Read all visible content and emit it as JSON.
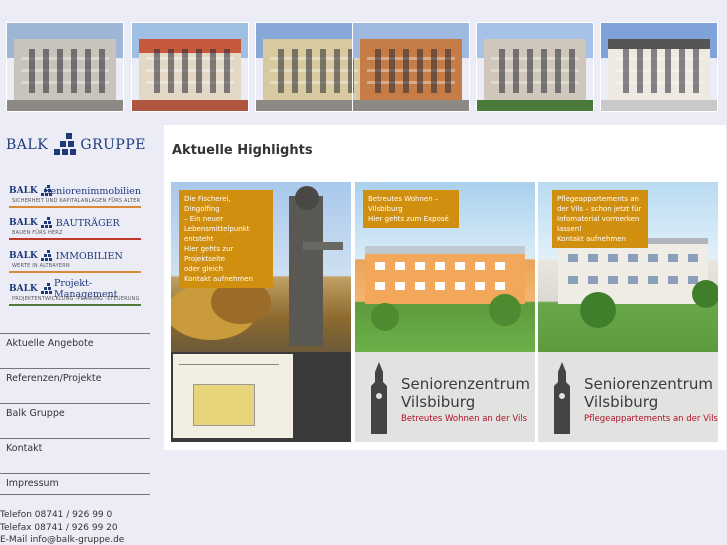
{
  "header": {
    "photos": [
      {
        "name": "photo-apartment-1",
        "sky": "#9db6d6",
        "building": "#c9c4bb"
      },
      {
        "name": "photo-apartment-2",
        "sky": "#9fc0e3",
        "building": "#c7573d"
      },
      {
        "name": "photo-apartment-3",
        "sky": "#88a9d8",
        "building": "#d8c9a0"
      },
      {
        "name": "photo-apartment-4",
        "sky": "#9fb8df",
        "building": "#c57c47"
      },
      {
        "name": "photo-apartment-5",
        "sky": "#a6c2e8",
        "building": "#cfc7bb"
      },
      {
        "name": "photo-apartment-6",
        "sky": "#7fa2d8",
        "building": "#eeeae2"
      }
    ]
  },
  "sidebar": {
    "logo": {
      "left": "BALK",
      "right": "GRUPPE"
    },
    "brands": [
      {
        "name": "BALK",
        "suffix": "Seniorenimmobilien",
        "tagline": "SICHERHEIT UND KAPITALANLAGEN FÜRS ALTER",
        "line_color": "#d9893a"
      },
      {
        "name": "BALK",
        "suffix": "BAUTRÄGER",
        "tagline": "BAUEN FÜRS HERZ",
        "line_color": "#c0392b"
      },
      {
        "name": "BALK",
        "suffix": "IMMOBILIEN",
        "tagline": "WERTE IN ALTBAYERN",
        "line_color": "#d9893a"
      },
      {
        "name": "BALK",
        "suffix": "Projekt-Management",
        "tagline": "PROJEKTENTWICKLUNG -PLANUNG -STEUERUNG",
        "line_color": "#4e7a3a"
      }
    ],
    "nav": [
      {
        "label": "Aktuelle Angebote"
      },
      {
        "label": "Referenzen/Projekte"
      },
      {
        "label": "Balk Gruppe"
      },
      {
        "label": "Kontakt"
      },
      {
        "label": "Impressum"
      }
    ],
    "contact": {
      "phone": "Telefon 08741 / 926 99 0",
      "fax": "Telefax 08741 / 926 99 20",
      "email": "E-Mail info@balk-gruppe.de"
    }
  },
  "main": {
    "title": "Aktuelle Highlights",
    "cards": [
      {
        "overlay_lines": [
          "Die Fischerei, Dingolfing",
          "– Ein neuer",
          "Lebensmittelpunkt",
          "entsteht"
        ],
        "links": [
          "Hier gehts zur",
          "Projektseite",
          "oder gleich",
          "Kontakt aufnehmen"
        ],
        "theme": "statue"
      },
      {
        "overlay_lines": [
          "Betreutes Wohnen –",
          "Vilsbiburg"
        ],
        "links": [
          "Hier gehts zum Exposé"
        ],
        "bottom_title": [
          "Seniorenzentrum",
          "Vilsbiburg"
        ],
        "bottom_subtitle": "Betreutes Wohnen an der Vils",
        "theme": "building-orange"
      },
      {
        "overlay_lines": [
          "Pflegeappartements an",
          "der Vils – schon jetzt für",
          "Infomaterial vormerken",
          "lassen!"
        ],
        "links": [
          "Kontakt aufnehmen"
        ],
        "bottom_title": [
          "Seniorenzentrum",
          "Vilsbiburg"
        ],
        "bottom_subtitle": "Pflegeappartements an der Vils",
        "theme": "building-white"
      }
    ]
  },
  "colors": {
    "background": "#ececf7",
    "brand_blue": "#1e3a78",
    "overlay_orange": "#d18f10",
    "subtitle_red": "#b0102a"
  }
}
